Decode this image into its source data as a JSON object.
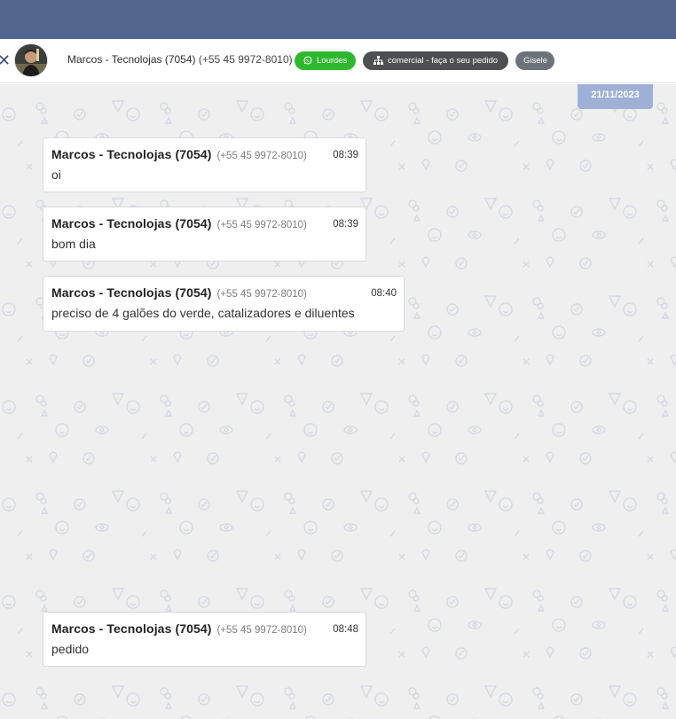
{
  "header": {
    "contact_name": "Marcos - Tecnolojas (7054)",
    "contact_phone": "(+55 45 9972-8010)",
    "tags": {
      "whatsapp": "Lourdes",
      "department": "comercial - faça o seu pedido",
      "user": "Gisele"
    },
    "colors": {
      "topbar": "#53658f",
      "whatsapp_tag": "#2eb82e",
      "department_tag": "#4d4f52",
      "user_tag": "#6c727a"
    }
  },
  "chat": {
    "date_chip": "21/11/2023",
    "messages": [
      {
        "sender": "Marcos - Tecnolojas (7054)",
        "phone": "(+55 45 9972-8010)",
        "time": "08:39",
        "text": "oi"
      },
      {
        "sender": "Marcos - Tecnolojas (7054)",
        "phone": "(+55 45 9972-8010)",
        "time": "08:39",
        "text": "bom dia"
      },
      {
        "sender": "Marcos - Tecnolojas (7054)",
        "phone": "(+55 45 9972-8010)",
        "time": "08:40",
        "text": "preciso de 4 galões do verde, catalizadores e diluentes"
      },
      {
        "sender": "Marcos - Tecnolojas (7054)",
        "phone": "(+55 45 9972-8010)",
        "time": "08:48",
        "text": "pedido"
      }
    ]
  },
  "icons": {
    "close": "close-icon",
    "whatsapp": "whatsapp-icon",
    "department": "sitemap-icon"
  }
}
